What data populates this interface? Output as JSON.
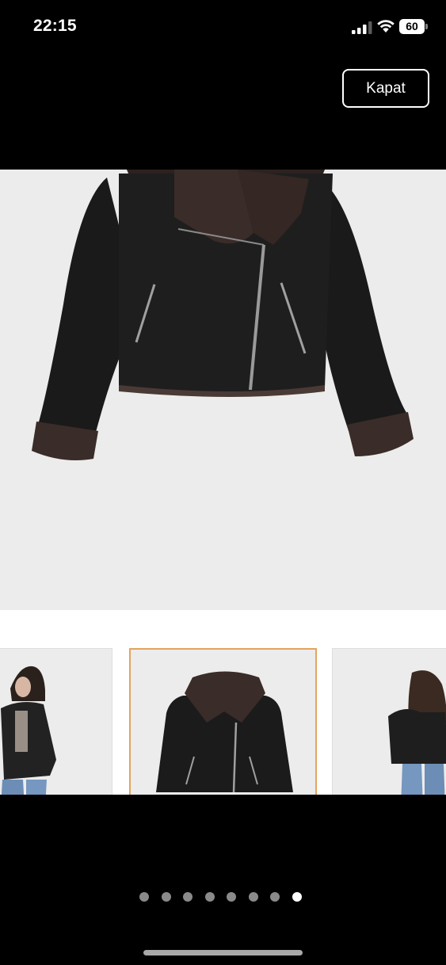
{
  "status_bar": {
    "time": "22:15",
    "battery_level": "60"
  },
  "gallery": {
    "close_label": "Kapat",
    "page_count": 8,
    "active_page": 8,
    "thumbnails": [
      {
        "name": "model-front-view",
        "selected": false
      },
      {
        "name": "product-front-view",
        "selected": true
      },
      {
        "name": "model-back-view",
        "selected": false
      }
    ]
  },
  "colors": {
    "background": "#000000",
    "image_background": "#ececec",
    "selected_border": "#e2a45c",
    "jacket": "#1b1b1b",
    "shearling": "#3a2c28"
  }
}
